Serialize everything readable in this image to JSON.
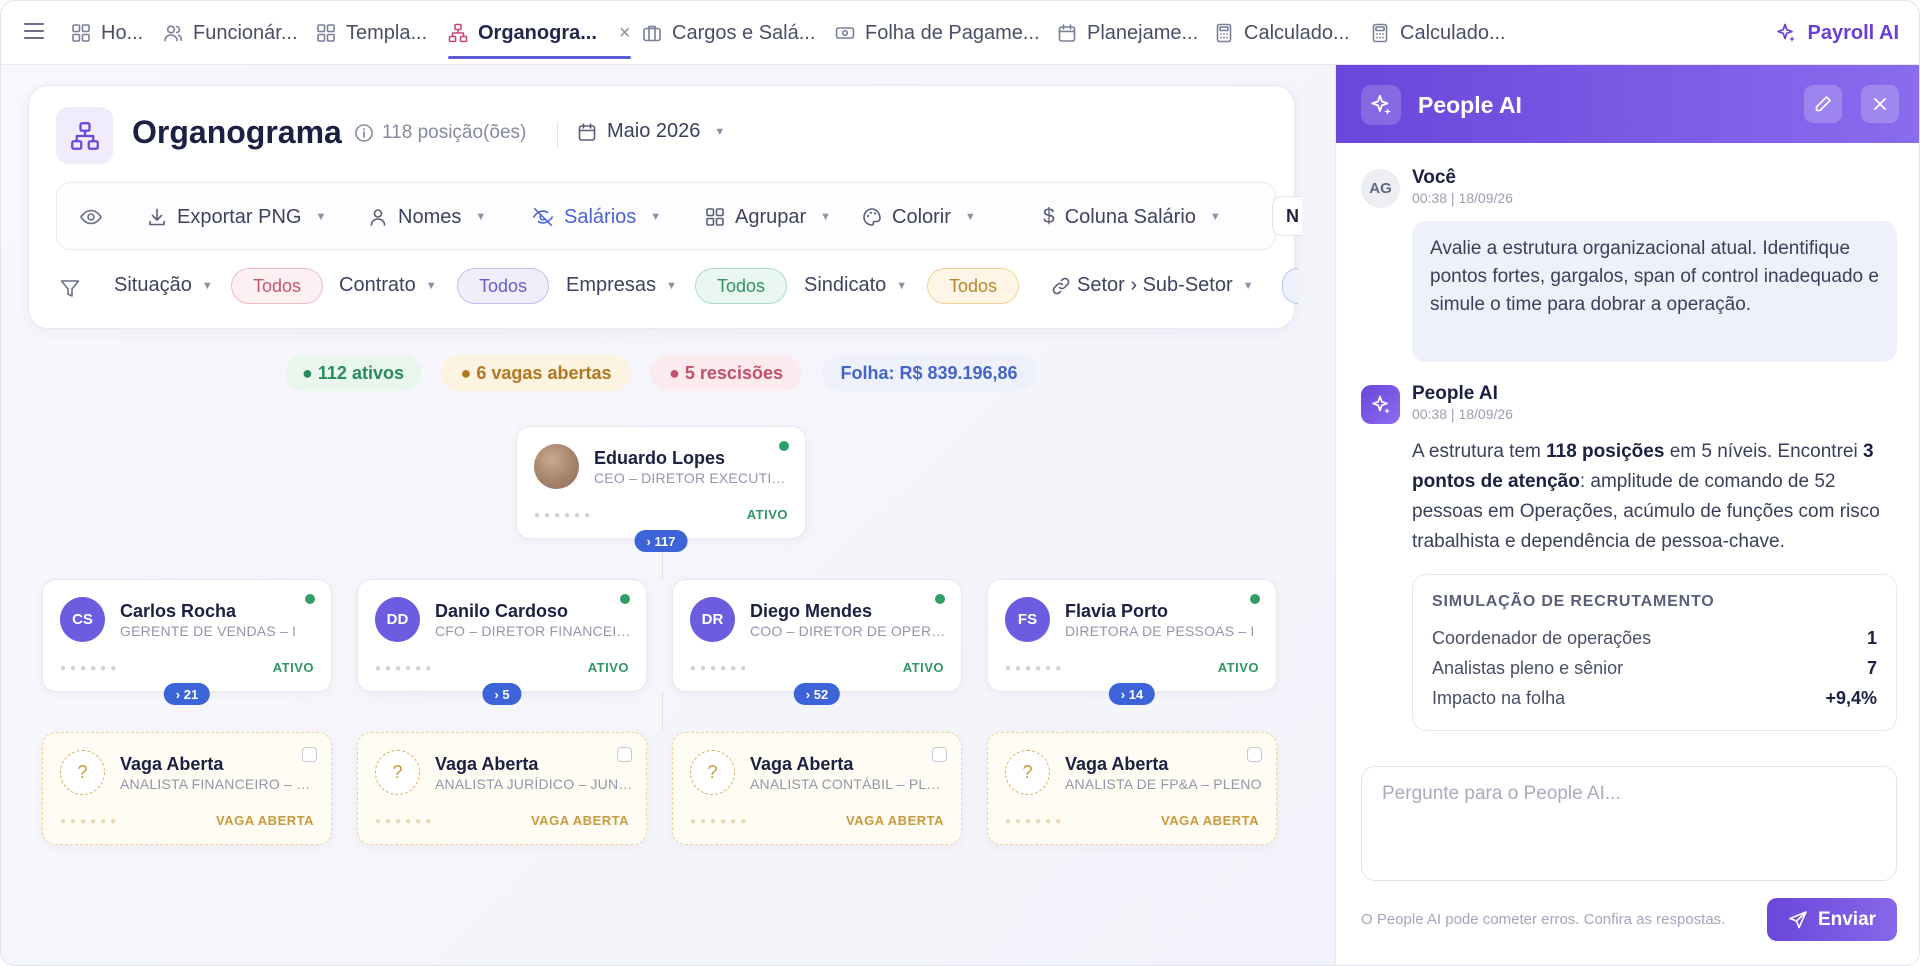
{
  "tabs": [
    {
      "label": "Ho...",
      "icon": "grid-icon"
    },
    {
      "label": "Funcionár...",
      "icon": "users-icon"
    },
    {
      "label": "Templa...",
      "icon": "grid-icon"
    },
    {
      "label": "Organogra...",
      "icon": "org-chart-icon",
      "active": true
    },
    {
      "label": "Cargos e Salá...",
      "icon": "briefcase-icon"
    },
    {
      "label": "Folha de Pagame...",
      "icon": "money-icon"
    },
    {
      "label": "Planejame...",
      "icon": "calendar-icon"
    },
    {
      "label": "Calculado...",
      "icon": "calculator-icon"
    },
    {
      "label": "Calculado...",
      "icon": "calculator-icon"
    }
  ],
  "tab_close": "×",
  "payroll_ai_label": "Payroll AI",
  "header": {
    "title": "Organograma",
    "positions": "118 posição(ões)",
    "period": "Maio 2026"
  },
  "toolbar": {
    "export": "Exportar PNG",
    "names": "Nomes",
    "salaries": "Salários",
    "group": "Agrupar",
    "color": "Colorir",
    "salary_column": "Coluna Salário",
    "overflow": "N"
  },
  "filters": [
    {
      "label": "Situação",
      "value": "Todos"
    },
    {
      "label": "Contrato",
      "value": "Todos"
    },
    {
      "label": "Empresas",
      "value": "Todos"
    },
    {
      "label": "Sindicato",
      "value": "Todos"
    }
  ],
  "hierarchy_filter": "Setor › Sub-Setor",
  "summary": {
    "active": "● 112 ativos",
    "open": "● 6 vagas abertas",
    "terminations": "● 5 rescisões",
    "payroll": "Folha: R$ 839.196,86"
  },
  "root_node": {
    "name": "Eduardo Lopes",
    "role": "CEO – DIRETOR EXECUTIVO – I",
    "status": "ATIVO",
    "reports": "› 117"
  },
  "managers": [
    {
      "initials": "CS",
      "name": "Carlos Rocha",
      "role": "GERENTE DE VENDAS – I",
      "status": "ATIVO",
      "reports": "› 21"
    },
    {
      "initials": "DD",
      "name": "Danilo Cardoso",
      "role": "CFO – DIRETOR FINANCEIRO – I",
      "status": "ATIVO",
      "reports": "› 5"
    },
    {
      "initials": "DR",
      "name": "Diego Mendes",
      "role": "COO – DIRETOR DE OPERAÇÕES",
      "status": "ATIVO",
      "reports": "› 52"
    },
    {
      "initials": "FS",
      "name": "Flavia Porto",
      "role": "DIRETORA DE PESSOAS – I",
      "status": "ATIVO",
      "reports": "› 14"
    }
  ],
  "vacancies": [
    {
      "name": "Vaga Aberta",
      "role": "ANALISTA FINANCEIRO – SENIOR",
      "status": "VAGA ABERTA"
    },
    {
      "name": "Vaga Aberta",
      "role": "ANALISTA JURÍDICO – JUNIOR",
      "status": "VAGA ABERTA"
    },
    {
      "name": "Vaga Aberta",
      "role": "ANALISTA CONTÁBIL – PLENO",
      "status": "VAGA ABERTA"
    },
    {
      "name": "Vaga Aberta",
      "role": "ANALISTA DE FP&A – PLENO",
      "status": "VAGA ABERTA"
    }
  ],
  "vacancy_avatar": "?",
  "ai_panel": {
    "title": "People AI",
    "user_initials": "AG",
    "user_name": "Você",
    "user_time": "00:38 | 18/09/26",
    "user_message": "Avalie a estrutura organizacional atual. Identifique pontos fortes, gargalos, span of control inadequado e simule o time para dobrar a operação.",
    "ai_name": "People AI",
    "ai_time": "00:38 | 18/09/26",
    "ai_msg_p1": "A estrutura tem ",
    "ai_msg_b1": "118 posições",
    "ai_msg_p2": " em 5 níveis. Encontrei ",
    "ai_msg_b2": "3 pontos de atenção",
    "ai_msg_p3": ": amplitude de comando de 52 pessoas em Operações, acúmulo de funções com risco trabalhista e dependência de pessoa-chave.",
    "sim_title": "SIMULAÇÃO DE RECRUTAMENTO",
    "sim_rows": [
      {
        "label": "Coordenador de operações",
        "value": "1"
      },
      {
        "label": "Analistas pleno e sênior",
        "value": "7"
      },
      {
        "label": "Impacto na folha",
        "value": "+9,4%"
      }
    ],
    "input_placeholder": "Pergunte para o People AI...",
    "disclaimer": "O People AI pode cometer erros. Confira as respostas.",
    "send_label": "Enviar"
  },
  "colors": {
    "accent": "#6a46da",
    "active_green": "#2f9e67",
    "vacancy_gold": "#c99a3d",
    "badge_blue": "#3c63d8"
  }
}
